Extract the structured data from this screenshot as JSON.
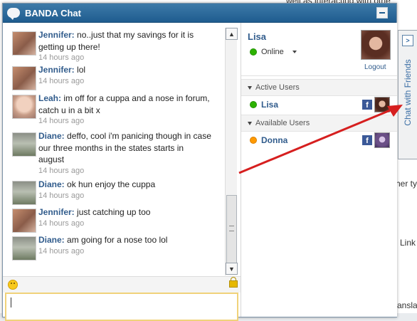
{
  "window": {
    "title": "BANDA Chat"
  },
  "background_text": {
    "top": "well as interacting with othe",
    "t1": "her ty",
    "t2": "Link",
    "t3": "ansla"
  },
  "messages": [
    {
      "author": "Jennifer:",
      "avatar": "jennifer",
      "lines": [
        "no..just that my savings for it is",
        "getting up there!"
      ],
      "time": "14 hours ago"
    },
    {
      "author": "Jennifer:",
      "avatar": "jennifer",
      "lines": [
        "lol"
      ],
      "time": "14 hours ago"
    },
    {
      "author": "Leah:",
      "avatar": "leah",
      "lines": [
        "im off for a cuppa and a nose in forum,",
        "catch u in a bit x"
      ],
      "time": "14 hours ago"
    },
    {
      "author": "Diane:",
      "avatar": "diane",
      "lines": [
        "deffo, cool i'm panicing though in case",
        "our three months in the states starts in",
        "august"
      ],
      "time": "14 hours ago"
    },
    {
      "author": "Diane:",
      "avatar": "diane",
      "lines": [
        "ok hun enjoy the cuppa"
      ],
      "time": "14 hours ago"
    },
    {
      "author": "Jennifer:",
      "avatar": "jennifer",
      "lines": [
        "just catching up too"
      ],
      "time": "14 hours ago"
    },
    {
      "author": "Diane:",
      "avatar": "diane",
      "lines": [
        "am going for a nose too lol"
      ],
      "time": "14 hours ago"
    }
  ],
  "me": {
    "name": "Lisa",
    "status": "Online",
    "logout": "Logout"
  },
  "groups": {
    "active": {
      "label": "Active Users",
      "users": [
        {
          "name": "Lisa",
          "status": "online",
          "status_color": "#2db200"
        }
      ]
    },
    "available": {
      "label": "Available Users",
      "users": [
        {
          "name": "Donna",
          "status": "away",
          "status_color": "#ff9a00"
        }
      ]
    }
  },
  "side_tab": {
    "label": "Chat with Friends",
    "toggle": ">"
  },
  "colors": {
    "accent": "#1f5c8f",
    "name_blue": "#315c8c",
    "arrow_red": "#d61f1f"
  }
}
